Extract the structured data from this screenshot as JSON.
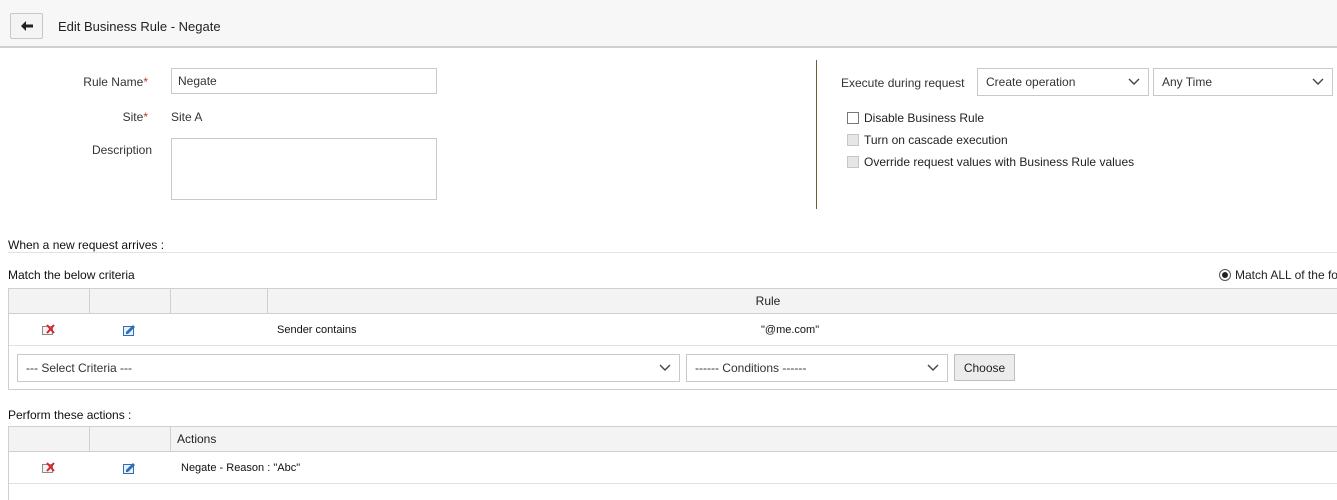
{
  "header": {
    "title": "Edit Business Rule - Negate",
    "back_icon": "arrow-left-icon"
  },
  "form": {
    "rule_name_label": "Rule Name",
    "rule_name_value": "Negate",
    "site_label": "Site",
    "site_value": "Site A",
    "description_label": "Description",
    "description_value": "",
    "required_marker": "*"
  },
  "execution": {
    "label": "Execute during request",
    "operation_selected": "Create operation",
    "time_selected": "Any Time",
    "checkboxes": [
      {
        "label": "Disable Business Rule",
        "checked": false,
        "disabled": false
      },
      {
        "label": "Turn on cascade execution",
        "checked": false,
        "disabled": true
      },
      {
        "label": "Override request values with Business Rule values",
        "checked": false,
        "disabled": true
      }
    ]
  },
  "criteria": {
    "when_label": "When a new request arrives :",
    "match_label": "Match the below criteria",
    "match_all_label": "Match ALL of the fo",
    "rule_column": "Rule",
    "rows": [
      {
        "rule": "Sender contains",
        "value": "\"@me.com\""
      }
    ],
    "select_criteria_placeholder": "--- Select Criteria ---",
    "conditions_placeholder": "------ Conditions ------",
    "choose_label": "Choose"
  },
  "actions": {
    "perform_label": "Perform these actions :",
    "actions_column": "Actions",
    "rows": [
      {
        "action": "Negate - Reason : \"Abc\""
      }
    ]
  },
  "colors": {
    "delete_icon": "#d9262c",
    "edit_icon": "#2f6fb8",
    "divider": "#6b5e3a"
  }
}
